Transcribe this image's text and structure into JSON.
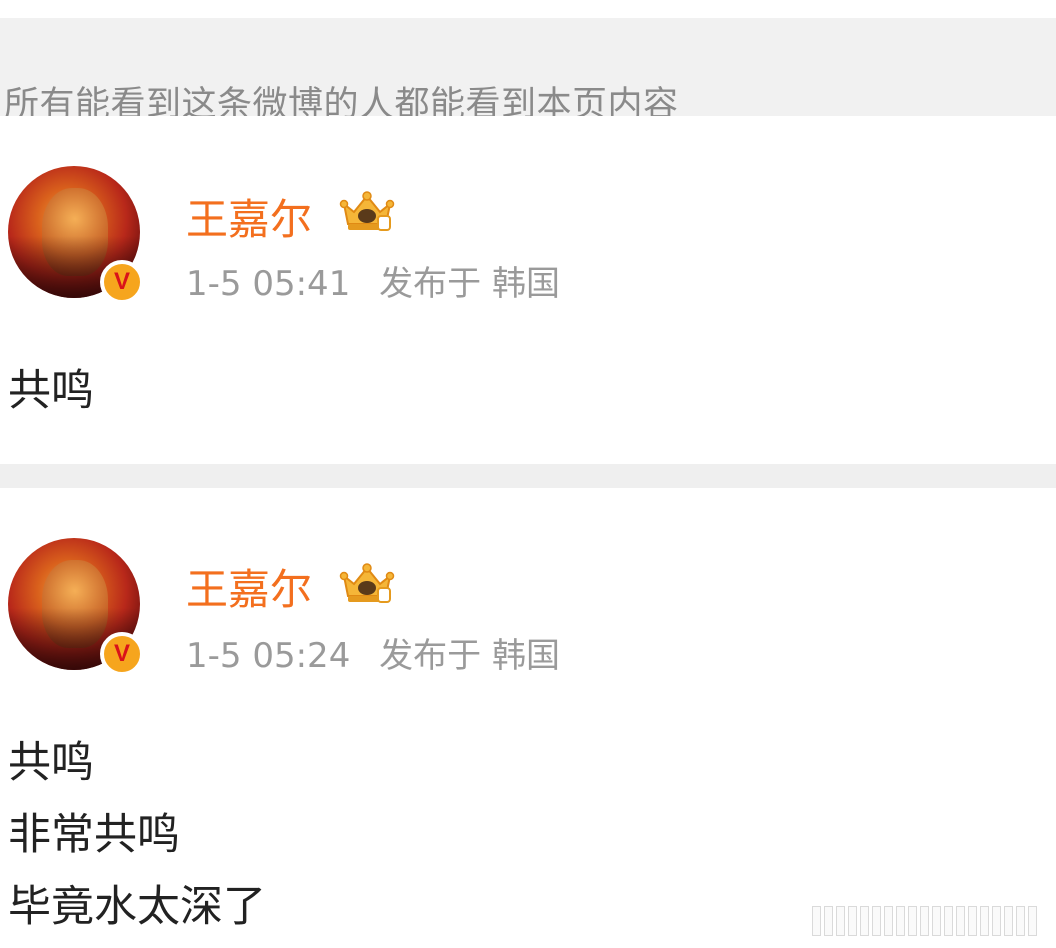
{
  "notice": "所有能看到这条微博的人都能看到本页内容",
  "posts": [
    {
      "username": "王嘉尔",
      "time": "1-5 05:41",
      "published": "发布于",
      "location": "韩国",
      "content": [
        "共鸣"
      ]
    },
    {
      "username": "王嘉尔",
      "time": "1-5 05:24",
      "published": "发布于",
      "location": "韩国",
      "content": [
        "共鸣",
        "非常共鸣",
        "毕竟水太深了"
      ]
    }
  ],
  "colors": {
    "username": "#f36f1e",
    "meta": "#9a9a9a",
    "notice_bg": "#f1f1f1",
    "verified_badge": "#f6a51d"
  },
  "icons": {
    "verified": "verified-v-icon",
    "crown": "crown-icon"
  }
}
